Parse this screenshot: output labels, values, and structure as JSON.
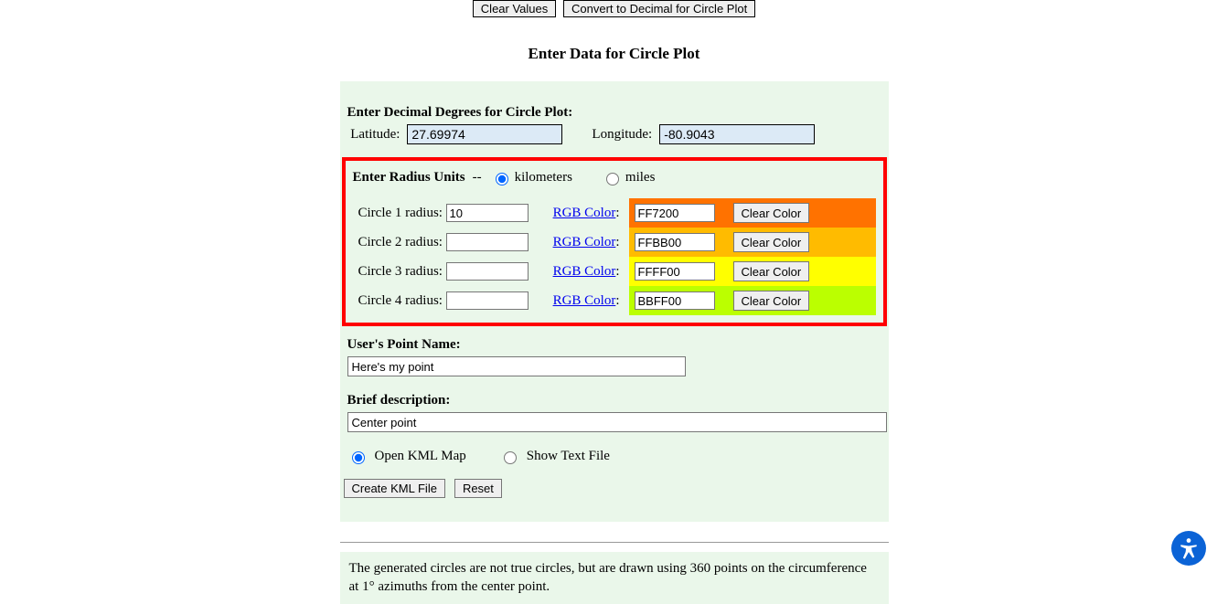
{
  "topButtons": {
    "clearValues": "Clear Values",
    "convertDecimal": "Convert to Decimal for Circle Plot"
  },
  "heading": "Enter Data for Circle Plot",
  "decimalSection": {
    "title": "Enter Decimal Degrees for Circle Plot:",
    "latLabel": "Latitude:",
    "latValue": "27.69974",
    "lonLabel": "Longitude:",
    "lonValue": "-80.9043"
  },
  "radiusSection": {
    "title": "Enter Radius Units",
    "dashes": "--",
    "kmLabel": "kilometers",
    "milesLabel": "miles",
    "rgbLinkText": "RGB Color",
    "clearColorLabel": "Clear Color",
    "circles": [
      {
        "label": "Circle 1 radius:",
        "radius": "10",
        "color": "FF7200",
        "bg": "#FF7200"
      },
      {
        "label": "Circle 2 radius:",
        "radius": "",
        "color": "FFBB00",
        "bg": "#FFBB00"
      },
      {
        "label": "Circle 3 radius:",
        "radius": "",
        "color": "FFFF00",
        "bg": "#FFFF00"
      },
      {
        "label": "Circle 4 radius:",
        "radius": "",
        "color": "BBFF00",
        "bg": "#BBFF00"
      }
    ]
  },
  "pointName": {
    "title": "User's Point Name:",
    "value": "Here's my point"
  },
  "description": {
    "title": "Brief description:",
    "value": "Center point"
  },
  "outputOptions": {
    "openKml": "Open KML Map",
    "showText": "Show Text File"
  },
  "bottomButtons": {
    "create": "Create KML File",
    "reset": "Reset"
  },
  "note": "The generated circles are not true circles, but are drawn using 360 points on the circumference at 1° azimuths from the center point."
}
